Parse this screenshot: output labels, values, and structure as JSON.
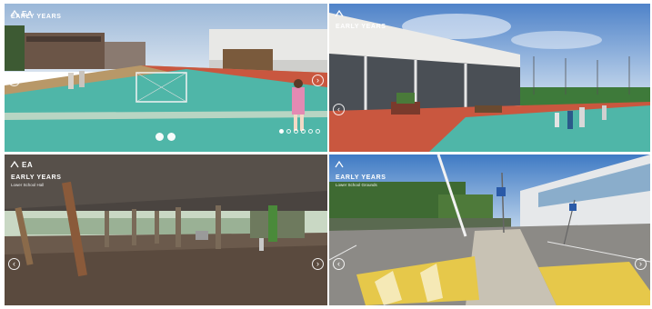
{
  "panels": [
    {
      "id": "outdoor-court",
      "logo": "EA",
      "title": "EARLY YEARS",
      "subtitle": "",
      "menu": [
        "",
        "",
        "",
        ""
      ],
      "controls": [
        "view-icon",
        "info-icon"
      ]
    },
    {
      "id": "building-exterior",
      "logo": "",
      "title": "EARLY YEARS",
      "subtitle": "",
      "menu": [
        "",
        "",
        "",
        ""
      ]
    },
    {
      "id": "covered-hall",
      "logo": "EA",
      "title": "EARLY YEARS",
      "subtitle": "Lower School Hall",
      "menu": [
        "",
        "",
        "",
        ""
      ]
    },
    {
      "id": "crosswalk",
      "logo": "",
      "title": "EARLY YEARS",
      "subtitle": "Lower School Grounds",
      "menu": [
        "",
        "",
        "",
        ""
      ]
    }
  ],
  "nav": {
    "prev": "‹",
    "next": "›"
  },
  "colors": {
    "court_teal": "#4fb6a8",
    "track_red": "#c9573f",
    "sky_blue": "#5e8fcf",
    "crosswalk_yellow": "#e6c84a"
  }
}
